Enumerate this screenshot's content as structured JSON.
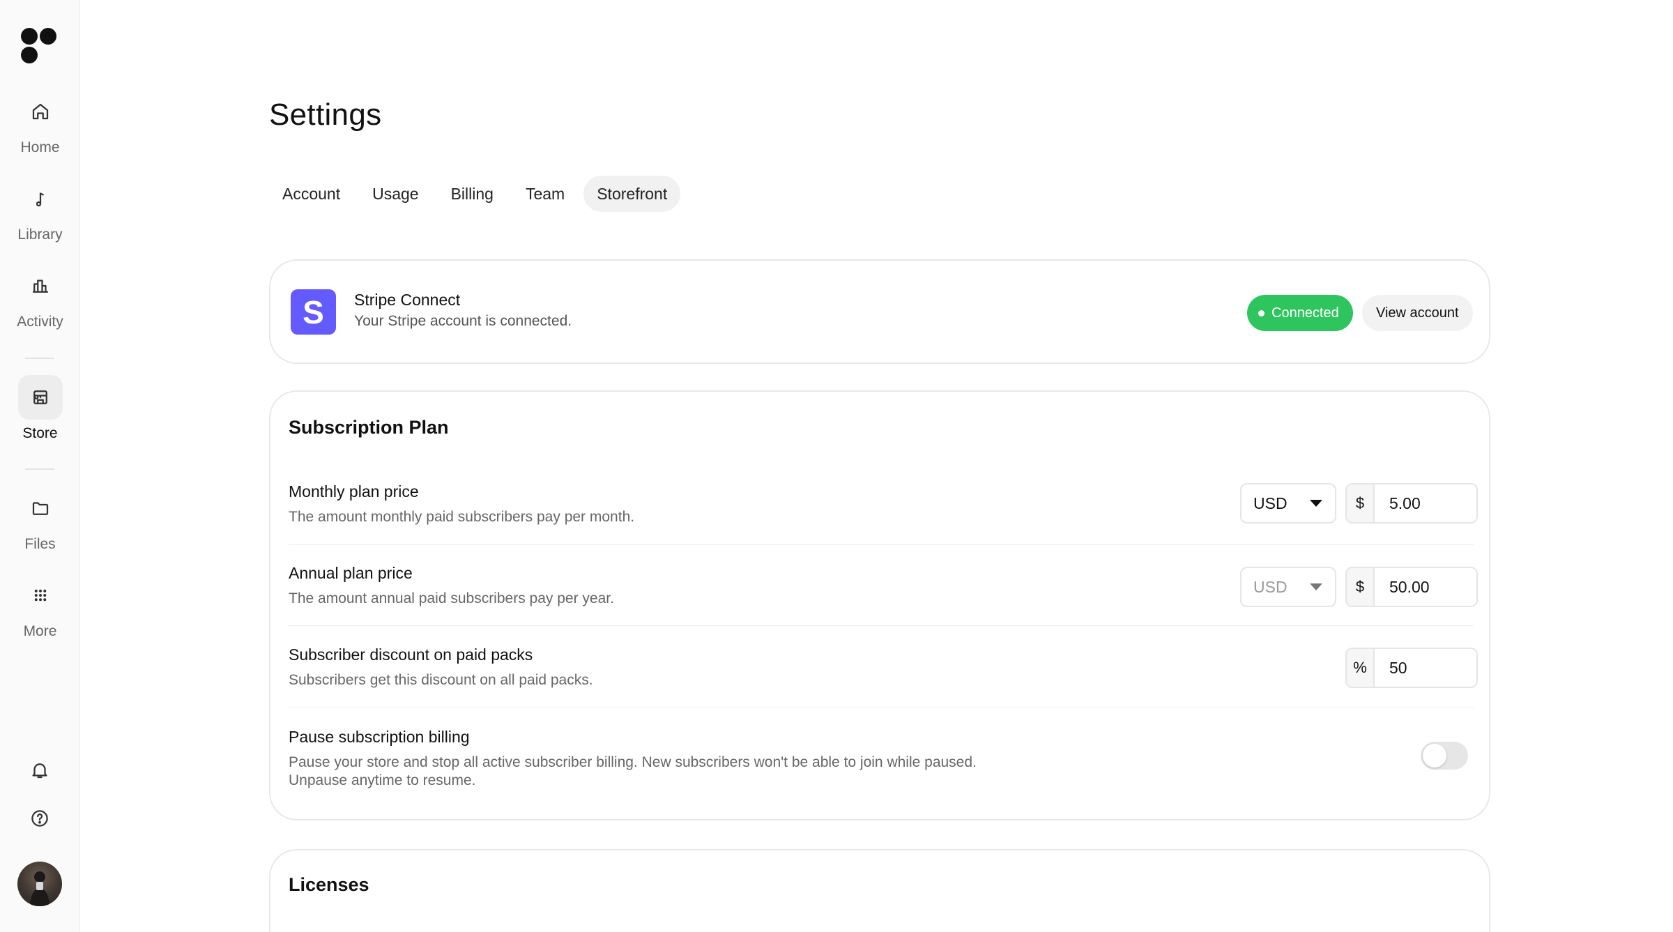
{
  "sidebar": {
    "items": [
      {
        "label": "Home",
        "icon": "home-icon"
      },
      {
        "label": "Library",
        "icon": "music-note-icon"
      },
      {
        "label": "Activity",
        "icon": "bar-chart-icon"
      },
      {
        "label": "Store",
        "icon": "store-icon",
        "active": true
      },
      {
        "label": "Files",
        "icon": "folder-icon"
      },
      {
        "label": "More",
        "icon": "grid-dots-icon"
      }
    ],
    "bottom": {
      "notifications_icon": "bell-icon",
      "help_icon": "help-circle-icon",
      "avatar": "user-avatar"
    }
  },
  "page": {
    "title": "Settings"
  },
  "tabs": [
    {
      "label": "Account"
    },
    {
      "label": "Usage"
    },
    {
      "label": "Billing"
    },
    {
      "label": "Team"
    },
    {
      "label": "Storefront",
      "active": true
    }
  ],
  "stripe": {
    "logo_letter": "S",
    "title": "Stripe Connect",
    "subtitle": "Your Stripe account is connected.",
    "status": "Connected",
    "view_button": "View account",
    "brand_color": "#635bff",
    "status_color": "#2ec55e"
  },
  "subscription": {
    "title": "Subscription Plan",
    "monthly": {
      "title": "Monthly plan price",
      "desc": "The amount monthly paid subscribers pay per month.",
      "currency": "USD",
      "symbol": "$",
      "value": "5.00"
    },
    "annual": {
      "title": "Annual plan price",
      "desc": "The amount annual paid subscribers pay per year.",
      "currency": "USD",
      "symbol": "$",
      "value": "50.00"
    },
    "discount": {
      "title": "Subscriber discount on paid packs",
      "desc": "Subscribers get this discount on all paid packs.",
      "symbol": "%",
      "value": "50"
    },
    "pause": {
      "title": "Pause subscription billing",
      "desc_line1": "Pause your store and stop all active subscriber billing. New subscribers won't be able to join while paused.",
      "desc_line2": "Unpause anytime to resume.",
      "enabled": false
    }
  },
  "licenses": {
    "title": "Licenses"
  }
}
